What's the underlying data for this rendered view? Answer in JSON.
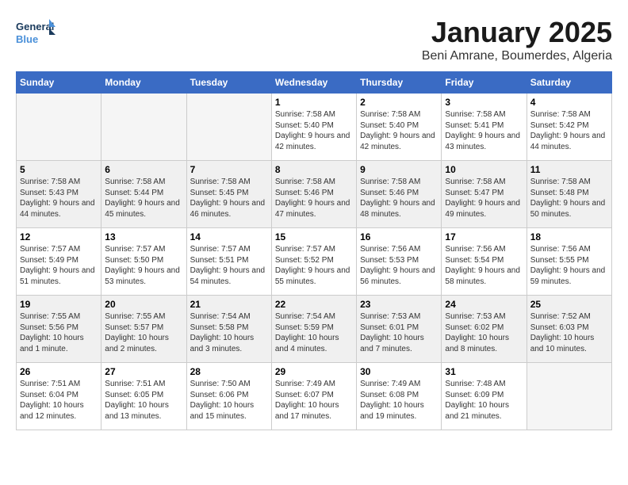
{
  "header": {
    "logo_line1": "General",
    "logo_line2": "Blue",
    "month": "January 2025",
    "location": "Beni Amrane, Boumerdes, Algeria"
  },
  "days_of_week": [
    "Sunday",
    "Monday",
    "Tuesday",
    "Wednesday",
    "Thursday",
    "Friday",
    "Saturday"
  ],
  "weeks": [
    [
      {
        "day": "",
        "sunrise": "",
        "sunset": "",
        "daylight": "",
        "empty": true
      },
      {
        "day": "",
        "sunrise": "",
        "sunset": "",
        "daylight": "",
        "empty": true
      },
      {
        "day": "",
        "sunrise": "",
        "sunset": "",
        "daylight": "",
        "empty": true
      },
      {
        "day": "1",
        "sunrise": "Sunrise: 7:58 AM",
        "sunset": "Sunset: 5:40 PM",
        "daylight": "Daylight: 9 hours and 42 minutes."
      },
      {
        "day": "2",
        "sunrise": "Sunrise: 7:58 AM",
        "sunset": "Sunset: 5:40 PM",
        "daylight": "Daylight: 9 hours and 42 minutes."
      },
      {
        "day": "3",
        "sunrise": "Sunrise: 7:58 AM",
        "sunset": "Sunset: 5:41 PM",
        "daylight": "Daylight: 9 hours and 43 minutes."
      },
      {
        "day": "4",
        "sunrise": "Sunrise: 7:58 AM",
        "sunset": "Sunset: 5:42 PM",
        "daylight": "Daylight: 9 hours and 44 minutes."
      }
    ],
    [
      {
        "day": "5",
        "sunrise": "Sunrise: 7:58 AM",
        "sunset": "Sunset: 5:43 PM",
        "daylight": "Daylight: 9 hours and 44 minutes."
      },
      {
        "day": "6",
        "sunrise": "Sunrise: 7:58 AM",
        "sunset": "Sunset: 5:44 PM",
        "daylight": "Daylight: 9 hours and 45 minutes."
      },
      {
        "day": "7",
        "sunrise": "Sunrise: 7:58 AM",
        "sunset": "Sunset: 5:45 PM",
        "daylight": "Daylight: 9 hours and 46 minutes."
      },
      {
        "day": "8",
        "sunrise": "Sunrise: 7:58 AM",
        "sunset": "Sunset: 5:46 PM",
        "daylight": "Daylight: 9 hours and 47 minutes."
      },
      {
        "day": "9",
        "sunrise": "Sunrise: 7:58 AM",
        "sunset": "Sunset: 5:46 PM",
        "daylight": "Daylight: 9 hours and 48 minutes."
      },
      {
        "day": "10",
        "sunrise": "Sunrise: 7:58 AM",
        "sunset": "Sunset: 5:47 PM",
        "daylight": "Daylight: 9 hours and 49 minutes."
      },
      {
        "day": "11",
        "sunrise": "Sunrise: 7:58 AM",
        "sunset": "Sunset: 5:48 PM",
        "daylight": "Daylight: 9 hours and 50 minutes."
      }
    ],
    [
      {
        "day": "12",
        "sunrise": "Sunrise: 7:57 AM",
        "sunset": "Sunset: 5:49 PM",
        "daylight": "Daylight: 9 hours and 51 minutes."
      },
      {
        "day": "13",
        "sunrise": "Sunrise: 7:57 AM",
        "sunset": "Sunset: 5:50 PM",
        "daylight": "Daylight: 9 hours and 53 minutes."
      },
      {
        "day": "14",
        "sunrise": "Sunrise: 7:57 AM",
        "sunset": "Sunset: 5:51 PM",
        "daylight": "Daylight: 9 hours and 54 minutes."
      },
      {
        "day": "15",
        "sunrise": "Sunrise: 7:57 AM",
        "sunset": "Sunset: 5:52 PM",
        "daylight": "Daylight: 9 hours and 55 minutes."
      },
      {
        "day": "16",
        "sunrise": "Sunrise: 7:56 AM",
        "sunset": "Sunset: 5:53 PM",
        "daylight": "Daylight: 9 hours and 56 minutes."
      },
      {
        "day": "17",
        "sunrise": "Sunrise: 7:56 AM",
        "sunset": "Sunset: 5:54 PM",
        "daylight": "Daylight: 9 hours and 58 minutes."
      },
      {
        "day": "18",
        "sunrise": "Sunrise: 7:56 AM",
        "sunset": "Sunset: 5:55 PM",
        "daylight": "Daylight: 9 hours and 59 minutes."
      }
    ],
    [
      {
        "day": "19",
        "sunrise": "Sunrise: 7:55 AM",
        "sunset": "Sunset: 5:56 PM",
        "daylight": "Daylight: 10 hours and 1 minute."
      },
      {
        "day": "20",
        "sunrise": "Sunrise: 7:55 AM",
        "sunset": "Sunset: 5:57 PM",
        "daylight": "Daylight: 10 hours and 2 minutes."
      },
      {
        "day": "21",
        "sunrise": "Sunrise: 7:54 AM",
        "sunset": "Sunset: 5:58 PM",
        "daylight": "Daylight: 10 hours and 3 minutes."
      },
      {
        "day": "22",
        "sunrise": "Sunrise: 7:54 AM",
        "sunset": "Sunset: 5:59 PM",
        "daylight": "Daylight: 10 hours and 4 minutes."
      },
      {
        "day": "23",
        "sunrise": "Sunrise: 7:53 AM",
        "sunset": "Sunset: 6:01 PM",
        "daylight": "Daylight: 10 hours and 7 minutes."
      },
      {
        "day": "24",
        "sunrise": "Sunrise: 7:53 AM",
        "sunset": "Sunset: 6:02 PM",
        "daylight": "Daylight: 10 hours and 8 minutes."
      },
      {
        "day": "25",
        "sunrise": "Sunrise: 7:52 AM",
        "sunset": "Sunset: 6:03 PM",
        "daylight": "Daylight: 10 hours and 10 minutes."
      }
    ],
    [
      {
        "day": "26",
        "sunrise": "Sunrise: 7:51 AM",
        "sunset": "Sunset: 6:04 PM",
        "daylight": "Daylight: 10 hours and 12 minutes."
      },
      {
        "day": "27",
        "sunrise": "Sunrise: 7:51 AM",
        "sunset": "Sunset: 6:05 PM",
        "daylight": "Daylight: 10 hours and 13 minutes."
      },
      {
        "day": "28",
        "sunrise": "Sunrise: 7:50 AM",
        "sunset": "Sunset: 6:06 PM",
        "daylight": "Daylight: 10 hours and 15 minutes."
      },
      {
        "day": "29",
        "sunrise": "Sunrise: 7:49 AM",
        "sunset": "Sunset: 6:07 PM",
        "daylight": "Daylight: 10 hours and 17 minutes."
      },
      {
        "day": "30",
        "sunrise": "Sunrise: 7:49 AM",
        "sunset": "Sunset: 6:08 PM",
        "daylight": "Daylight: 10 hours and 19 minutes."
      },
      {
        "day": "31",
        "sunrise": "Sunrise: 7:48 AM",
        "sunset": "Sunset: 6:09 PM",
        "daylight": "Daylight: 10 hours and 21 minutes."
      },
      {
        "day": "",
        "sunrise": "",
        "sunset": "",
        "daylight": "",
        "empty": true
      }
    ]
  ]
}
